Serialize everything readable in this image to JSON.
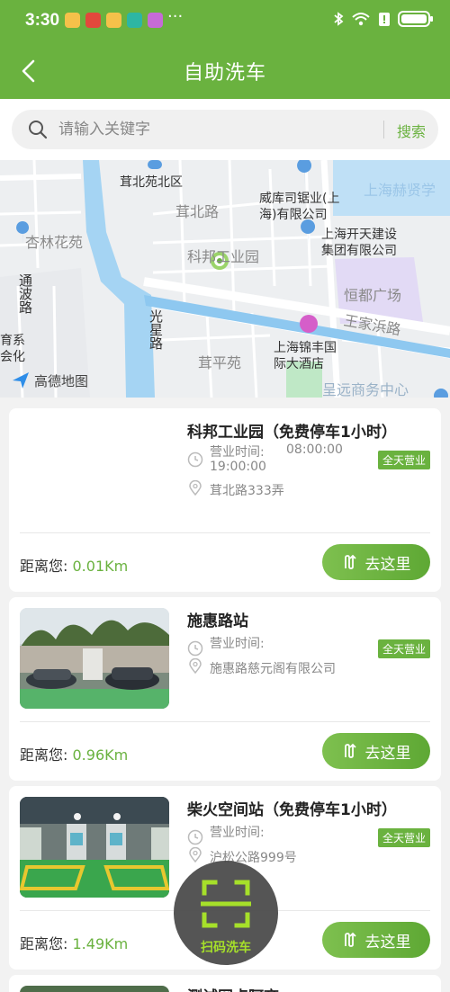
{
  "status": {
    "time": "3:30",
    "more": "···"
  },
  "header": {
    "title": "自助洗车"
  },
  "search": {
    "placeholder": "请输入关键字",
    "button": "搜索"
  },
  "map": {
    "labels": {
      "rongbei_north": "茸北苑北区",
      "rongbei_road": "茸北路",
      "weiku": "威库司锯业(上\n海)有限公司",
      "shanghai_hexian": "上海赫贤学",
      "xinglin": "杏林花苑",
      "kaitian": "上海开天建设\n集团有限公司",
      "kebang_park": "科邦工业园",
      "tongbo_road": "通波路",
      "hengdu": "恒都广场",
      "guangxing_road": "光星路",
      "wangjiabang": "王家浜路",
      "yuxi": "育系",
      "huihua": "会化",
      "jinfeng": "上海锦丰国\n际大酒店",
      "rongping": "茸平苑",
      "chengyuan": "呈远商务中心"
    },
    "logo": "高德地图"
  },
  "stations": [
    {
      "name": "科邦工业园（免费停车1小时）",
      "hours_label": "营业时间:",
      "hours": "08:00:00\n19:00:00",
      "badge": "全天营业",
      "address": "茸北路333弄",
      "distance_label": "距离您:",
      "distance": "0.01Km",
      "go": "去这里"
    },
    {
      "name": "施惠路站",
      "hours_label": "营业时间:",
      "hours": "",
      "badge": "全天营业",
      "address": "施惠路慈元阁有限公司",
      "distance_label": "距离您:",
      "distance": "0.96Km",
      "go": "去这里"
    },
    {
      "name": "柴火空间站（免费停车1小时）",
      "hours_label": "营业时间:",
      "hours": "",
      "badge": "全天营业",
      "address": "沪松公路999号",
      "distance_label": "距离您:",
      "distance": "1.49Km",
      "go": "去这里"
    },
    {
      "name": "测试网点阿商"
    }
  ],
  "scan": {
    "label": "扫码洗车"
  },
  "colors": {
    "brand": "#6ab23f",
    "scan_accent": "#a6e02a"
  }
}
